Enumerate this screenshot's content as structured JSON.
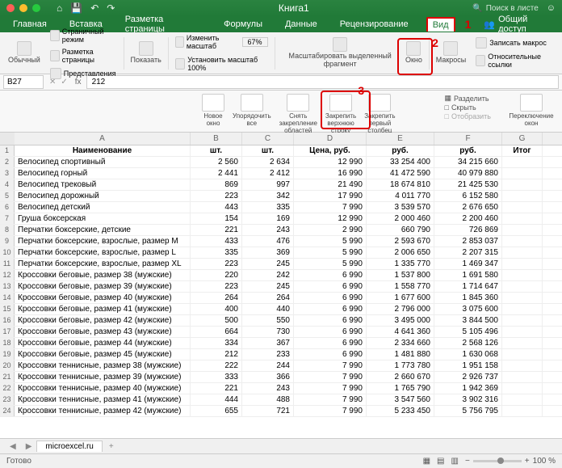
{
  "titlebar": {
    "title": "Книга1",
    "search": "Поиск в листе"
  },
  "tabs": [
    "Главная",
    "Вставка",
    "Разметка страницы",
    "Формулы",
    "Данные",
    "Рецензирование",
    "Вид"
  ],
  "tabs_active": 6,
  "share": "Общий доступ",
  "ribbon": {
    "normal": "Обычный",
    "page_layout": "Страничный режим",
    "page_break": "Разметка страницы",
    "custom": "Представления",
    "show": "Показать",
    "zoom_label": "Изменить масштаб",
    "zoom_val": "67%",
    "zoom100": "Установить масштаб 100%",
    "zoom_sel": "Масштабировать выделенный фрагмент",
    "window": "Окно",
    "macros": "Макросы",
    "record": "Записать макрос",
    "refs": "Относительные ссылки"
  },
  "subribbon": {
    "new_window": "Новое окно",
    "arrange": "Упорядочить все",
    "unfreeze": "Снять закрепление областей",
    "freeze_top": "Закрепить верхнюю строку",
    "freeze_first": "Закрепить первый столбец",
    "split": "Разделить",
    "hide": "Скрыть",
    "unhide": "Отобразить",
    "switch": "Переключение окон"
  },
  "callouts": {
    "1": "1",
    "2": "2",
    "3": "3"
  },
  "formula": {
    "cell": "B27",
    "fx": "fx",
    "value": "212"
  },
  "chart_data": {
    "type": "table",
    "columns": [
      "A",
      "B",
      "C",
      "D",
      "E",
      "F",
      "G"
    ],
    "headers": [
      "Наименование",
      "шт.",
      "шт.",
      "Цена, руб.",
      "руб.",
      "руб.",
      "Итог"
    ],
    "rows": [
      [
        "Велосипед спортивный",
        "2 560",
        "2 634",
        "12 990",
        "33 254 400",
        "34 215 660",
        ""
      ],
      [
        "Велосипед горный",
        "2 441",
        "2 412",
        "16 990",
        "41 472 590",
        "40 979 880",
        ""
      ],
      [
        "Велосипед трековый",
        "869",
        "997",
        "21 490",
        "18 674 810",
        "21 425 530",
        ""
      ],
      [
        "Велосипед дорожный",
        "223",
        "342",
        "17 990",
        "4 011 770",
        "6 152 580",
        ""
      ],
      [
        "Велосипед детский",
        "443",
        "335",
        "7 990",
        "3 539 570",
        "2 676 650",
        ""
      ],
      [
        "Груша боксерская",
        "154",
        "169",
        "12 990",
        "2 000 460",
        "2 200 460",
        ""
      ],
      [
        "Перчатки боксерские, детские",
        "221",
        "243",
        "2 990",
        "660 790",
        "726 869",
        ""
      ],
      [
        "Перчатки боксерские, взрослые, размер M",
        "433",
        "476",
        "5 990",
        "2 593 670",
        "2 853 037",
        ""
      ],
      [
        "Перчатки боксерские, взрослые, размер L",
        "335",
        "369",
        "5 990",
        "2 006 650",
        "2 207 315",
        ""
      ],
      [
        "Перчатки боксерские, взрослые, размер XL",
        "223",
        "245",
        "5 990",
        "1 335 770",
        "1 469 347",
        ""
      ],
      [
        "Кроссовки беговые, размер 38 (мужские)",
        "220",
        "242",
        "6 990",
        "1 537 800",
        "1 691 580",
        ""
      ],
      [
        "Кроссовки беговые, размер 39 (мужские)",
        "223",
        "245",
        "6 990",
        "1 558 770",
        "1 714 647",
        ""
      ],
      [
        "Кроссовки беговые, размер 40 (мужские)",
        "264",
        "264",
        "6 990",
        "1 677 600",
        "1 845 360",
        ""
      ],
      [
        "Кроссовки беговые, размер 41 (мужские)",
        "400",
        "440",
        "6 990",
        "2 796 000",
        "3 075 600",
        ""
      ],
      [
        "Кроссовки беговые, размер 42 (мужские)",
        "500",
        "550",
        "6 990",
        "3 495 000",
        "3 844 500",
        ""
      ],
      [
        "Кроссовки беговые, размер 43 (мужские)",
        "664",
        "730",
        "6 990",
        "4 641 360",
        "5 105 496",
        ""
      ],
      [
        "Кроссовки беговые, размер 44 (мужские)",
        "334",
        "367",
        "6 990",
        "2 334 660",
        "2 568 126",
        ""
      ],
      [
        "Кроссовки беговые, размер 45 (мужские)",
        "212",
        "233",
        "6 990",
        "1 481 880",
        "1 630 068",
        ""
      ],
      [
        "Кроссовки теннисные, размер 38 (мужские)",
        "222",
        "244",
        "7 990",
        "1 773 780",
        "1 951 158",
        ""
      ],
      [
        "Кроссовки теннисные, размер 39 (мужские)",
        "333",
        "366",
        "7 990",
        "2 660 670",
        "2 926 737",
        ""
      ],
      [
        "Кроссовки теннисные, размер 40 (мужские)",
        "221",
        "243",
        "7 990",
        "1 765 790",
        "1 942 369",
        ""
      ],
      [
        "Кроссовки теннисные, размер 41 (мужские)",
        "444",
        "488",
        "7 990",
        "3 547 560",
        "3 902 316",
        ""
      ],
      [
        "Кроссовки теннисные, размер 42 (мужские)",
        "655",
        "721",
        "7 990",
        "5 233 450",
        "5 756 795",
        ""
      ]
    ]
  },
  "sheet": "microexcel.ru",
  "status": {
    "ready": "Готово",
    "zoom": "100 %"
  }
}
